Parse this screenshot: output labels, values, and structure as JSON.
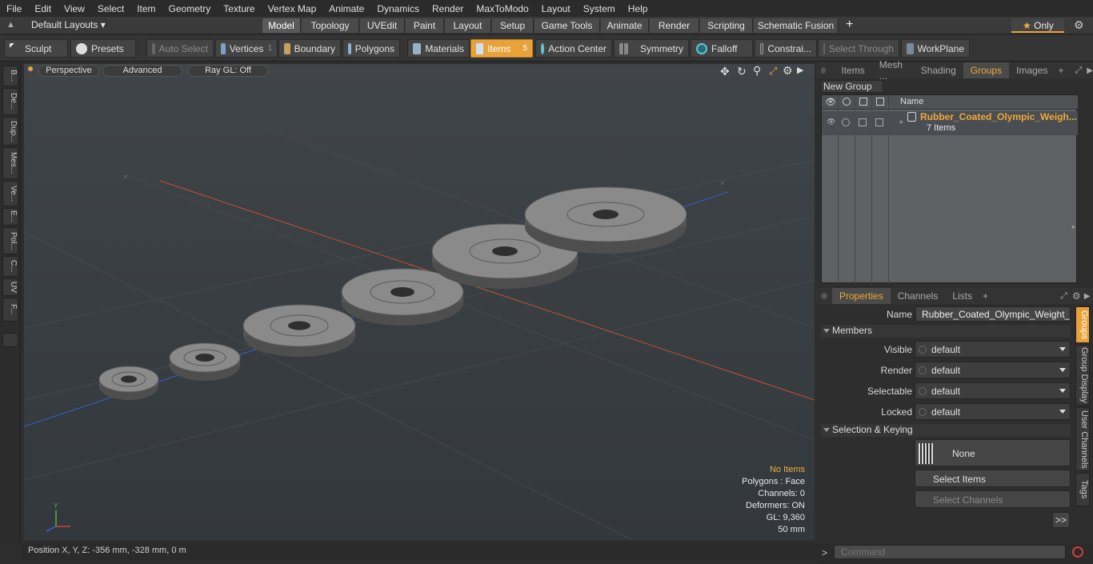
{
  "menu": [
    "File",
    "Edit",
    "View",
    "Select",
    "Item",
    "Geometry",
    "Texture",
    "Vertex Map",
    "Animate",
    "Dynamics",
    "Render",
    "MaxToModo",
    "Layout",
    "System",
    "Help"
  ],
  "layout_selector": "Default Layouts",
  "layout_tabs": [
    "Model",
    "Topology",
    "UVEdit",
    "Paint",
    "Layout",
    "Setup",
    "Game Tools",
    "Animate",
    "Render",
    "Scripting",
    "Schematic Fusion"
  ],
  "layout_tab_active": "Model",
  "only_label": "Only",
  "toolbar": {
    "sculpt": "Sculpt",
    "presets": "Presets",
    "auto_select": "Auto Select",
    "vertices": "Vertices",
    "vertices_count": "1",
    "boundary": "Boundary",
    "polygons": "Polygons",
    "materials": "Materials",
    "items": "Items",
    "items_count": "5",
    "action_center": "Action Center",
    "symmetry": "Symmetry",
    "falloff": "Falloff",
    "constraints": "Constrai...",
    "select_through": "Select Through",
    "workplane": "WorkPlane"
  },
  "left_tabs": [
    "B...",
    "De...",
    "Dup...",
    "Mes...",
    "Ve...",
    "E...",
    "Pol...",
    "C...",
    "UV",
    "F..."
  ],
  "viewport": {
    "perspective": "Perspective",
    "advanced": "Advanced",
    "raygl": "Ray GL: Off",
    "info": {
      "no_items": "No Items",
      "polygons": "Polygons : Face",
      "channels": "Channels: 0",
      "deformers": "Deformers: ON",
      "gl": "GL: 9,360",
      "scale": "50 mm"
    }
  },
  "status": {
    "position": "Position X, Y, Z:  -356 mm, -328 mm, 0 m"
  },
  "groups_panel": {
    "tabs": [
      "Items",
      "Mesh ...",
      "Shading",
      "Groups",
      "Images"
    ],
    "active_tab": "Groups",
    "new_group": "New Group",
    "name_col": "Name",
    "group_name": "Rubber_Coated_Olympic_Weigh...",
    "group_count": "7 Items"
  },
  "properties_panel": {
    "tabs": [
      "Properties",
      "Channels",
      "Lists"
    ],
    "active_tab": "Properties",
    "name_label": "Name",
    "name_value": "Rubber_Coated_Olympic_Weight_Plat",
    "members_header": "Members",
    "visible_label": "Visible",
    "visible_value": "default",
    "render_label": "Render",
    "render_value": "default",
    "selectable_label": "Selectable",
    "selectable_value": "default",
    "locked_label": "Locked",
    "locked_value": "default",
    "selection_header": "Selection & Keying",
    "none_label": "None",
    "select_items": "Select Items",
    "select_channels": "Select Channels",
    "more": ">>",
    "side_tabs": [
      "Groups",
      "Group Display",
      "User Channels",
      "Tags"
    ]
  },
  "command_placeholder": "Command",
  "colors": {
    "accent": "#e9a23b",
    "x_axis": "#c8502a",
    "z_axis": "#3a5cc8"
  }
}
